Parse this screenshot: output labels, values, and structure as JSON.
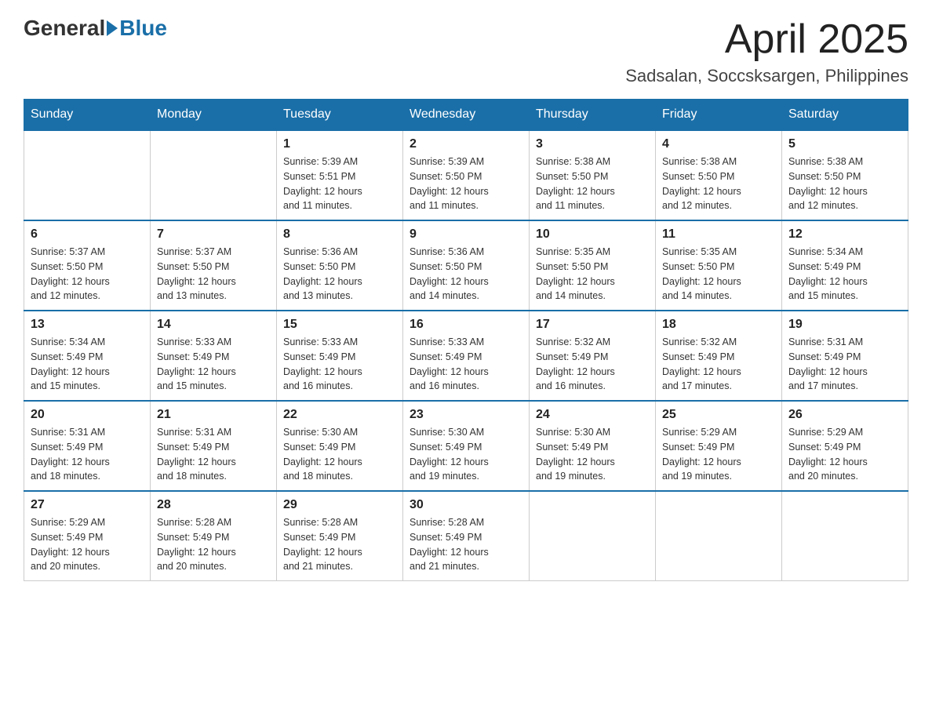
{
  "header": {
    "logo_general": "General",
    "logo_blue": "Blue",
    "month_title": "April 2025",
    "location": "Sadsalan, Soccsksargen, Philippines"
  },
  "weekdays": [
    "Sunday",
    "Monday",
    "Tuesday",
    "Wednesday",
    "Thursday",
    "Friday",
    "Saturday"
  ],
  "weeks": [
    [
      {
        "day": "",
        "info": ""
      },
      {
        "day": "",
        "info": ""
      },
      {
        "day": "1",
        "info": "Sunrise: 5:39 AM\nSunset: 5:51 PM\nDaylight: 12 hours\nand 11 minutes."
      },
      {
        "day": "2",
        "info": "Sunrise: 5:39 AM\nSunset: 5:50 PM\nDaylight: 12 hours\nand 11 minutes."
      },
      {
        "day": "3",
        "info": "Sunrise: 5:38 AM\nSunset: 5:50 PM\nDaylight: 12 hours\nand 11 minutes."
      },
      {
        "day": "4",
        "info": "Sunrise: 5:38 AM\nSunset: 5:50 PM\nDaylight: 12 hours\nand 12 minutes."
      },
      {
        "day": "5",
        "info": "Sunrise: 5:38 AM\nSunset: 5:50 PM\nDaylight: 12 hours\nand 12 minutes."
      }
    ],
    [
      {
        "day": "6",
        "info": "Sunrise: 5:37 AM\nSunset: 5:50 PM\nDaylight: 12 hours\nand 12 minutes."
      },
      {
        "day": "7",
        "info": "Sunrise: 5:37 AM\nSunset: 5:50 PM\nDaylight: 12 hours\nand 13 minutes."
      },
      {
        "day": "8",
        "info": "Sunrise: 5:36 AM\nSunset: 5:50 PM\nDaylight: 12 hours\nand 13 minutes."
      },
      {
        "day": "9",
        "info": "Sunrise: 5:36 AM\nSunset: 5:50 PM\nDaylight: 12 hours\nand 14 minutes."
      },
      {
        "day": "10",
        "info": "Sunrise: 5:35 AM\nSunset: 5:50 PM\nDaylight: 12 hours\nand 14 minutes."
      },
      {
        "day": "11",
        "info": "Sunrise: 5:35 AM\nSunset: 5:50 PM\nDaylight: 12 hours\nand 14 minutes."
      },
      {
        "day": "12",
        "info": "Sunrise: 5:34 AM\nSunset: 5:49 PM\nDaylight: 12 hours\nand 15 minutes."
      }
    ],
    [
      {
        "day": "13",
        "info": "Sunrise: 5:34 AM\nSunset: 5:49 PM\nDaylight: 12 hours\nand 15 minutes."
      },
      {
        "day": "14",
        "info": "Sunrise: 5:33 AM\nSunset: 5:49 PM\nDaylight: 12 hours\nand 15 minutes."
      },
      {
        "day": "15",
        "info": "Sunrise: 5:33 AM\nSunset: 5:49 PM\nDaylight: 12 hours\nand 16 minutes."
      },
      {
        "day": "16",
        "info": "Sunrise: 5:33 AM\nSunset: 5:49 PM\nDaylight: 12 hours\nand 16 minutes."
      },
      {
        "day": "17",
        "info": "Sunrise: 5:32 AM\nSunset: 5:49 PM\nDaylight: 12 hours\nand 16 minutes."
      },
      {
        "day": "18",
        "info": "Sunrise: 5:32 AM\nSunset: 5:49 PM\nDaylight: 12 hours\nand 17 minutes."
      },
      {
        "day": "19",
        "info": "Sunrise: 5:31 AM\nSunset: 5:49 PM\nDaylight: 12 hours\nand 17 minutes."
      }
    ],
    [
      {
        "day": "20",
        "info": "Sunrise: 5:31 AM\nSunset: 5:49 PM\nDaylight: 12 hours\nand 18 minutes."
      },
      {
        "day": "21",
        "info": "Sunrise: 5:31 AM\nSunset: 5:49 PM\nDaylight: 12 hours\nand 18 minutes."
      },
      {
        "day": "22",
        "info": "Sunrise: 5:30 AM\nSunset: 5:49 PM\nDaylight: 12 hours\nand 18 minutes."
      },
      {
        "day": "23",
        "info": "Sunrise: 5:30 AM\nSunset: 5:49 PM\nDaylight: 12 hours\nand 19 minutes."
      },
      {
        "day": "24",
        "info": "Sunrise: 5:30 AM\nSunset: 5:49 PM\nDaylight: 12 hours\nand 19 minutes."
      },
      {
        "day": "25",
        "info": "Sunrise: 5:29 AM\nSunset: 5:49 PM\nDaylight: 12 hours\nand 19 minutes."
      },
      {
        "day": "26",
        "info": "Sunrise: 5:29 AM\nSunset: 5:49 PM\nDaylight: 12 hours\nand 20 minutes."
      }
    ],
    [
      {
        "day": "27",
        "info": "Sunrise: 5:29 AM\nSunset: 5:49 PM\nDaylight: 12 hours\nand 20 minutes."
      },
      {
        "day": "28",
        "info": "Sunrise: 5:28 AM\nSunset: 5:49 PM\nDaylight: 12 hours\nand 20 minutes."
      },
      {
        "day": "29",
        "info": "Sunrise: 5:28 AM\nSunset: 5:49 PM\nDaylight: 12 hours\nand 21 minutes."
      },
      {
        "day": "30",
        "info": "Sunrise: 5:28 AM\nSunset: 5:49 PM\nDaylight: 12 hours\nand 21 minutes."
      },
      {
        "day": "",
        "info": ""
      },
      {
        "day": "",
        "info": ""
      },
      {
        "day": "",
        "info": ""
      }
    ]
  ]
}
